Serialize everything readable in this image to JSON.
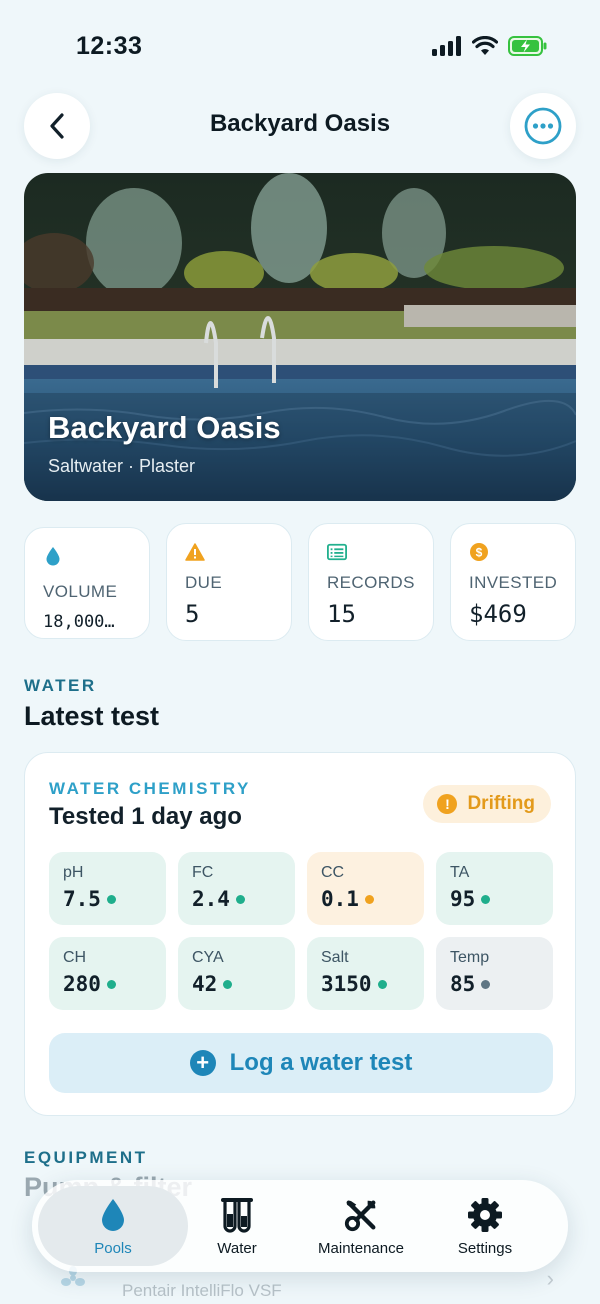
{
  "status_bar": {
    "time": "12:33"
  },
  "nav": {
    "title": "Backyard Oasis"
  },
  "hero": {
    "title": "Backyard Oasis",
    "subtitle": "Saltwater · Plaster"
  },
  "stats": [
    {
      "icon": "droplet-icon",
      "label": "VOLUME",
      "value": "18,000…"
    },
    {
      "icon": "warning-icon",
      "label": "DUE",
      "value": "5"
    },
    {
      "icon": "records-icon",
      "label": "RECORDS",
      "value": "15"
    },
    {
      "icon": "dollar-icon",
      "label": "INVESTED",
      "value": "$469"
    }
  ],
  "water_section": {
    "eyebrow": "WATER",
    "title": "Latest test"
  },
  "water_card": {
    "eyebrow": "WATER CHEMISTRY",
    "title": "Tested 1 day ago",
    "badge": "Drifting",
    "metrics": [
      {
        "label": "pH",
        "value": "7.5",
        "status": "ok"
      },
      {
        "label": "FC",
        "value": "2.4",
        "status": "ok"
      },
      {
        "label": "CC",
        "value": "0.1",
        "status": "warn"
      },
      {
        "label": "TA",
        "value": "95",
        "status": "ok"
      },
      {
        "label": "CH",
        "value": "280",
        "status": "ok"
      },
      {
        "label": "CYA",
        "value": "42",
        "status": "ok"
      },
      {
        "label": "Salt",
        "value": "3150",
        "status": "ok"
      },
      {
        "label": "Temp",
        "value": "85",
        "status": "neutral"
      }
    ],
    "log_button": "Log a water test"
  },
  "equipment_section": {
    "eyebrow": "EQUIPMENT",
    "title": "Pump & filter",
    "item_subtitle": "Pentair IntelliFlo VSF"
  },
  "tabs": [
    {
      "label": "Pools",
      "icon": "droplet-icon",
      "active": true
    },
    {
      "label": "Water",
      "icon": "test-tubes-icon",
      "active": false
    },
    {
      "label": "Maintenance",
      "icon": "tools-icon",
      "active": false
    },
    {
      "label": "Settings",
      "icon": "gear-icon",
      "active": false
    }
  ],
  "colors": {
    "accent": "#1e86b8",
    "ok": "#1fae8c",
    "warn": "#f0a21f",
    "background": "#eff7fa"
  }
}
